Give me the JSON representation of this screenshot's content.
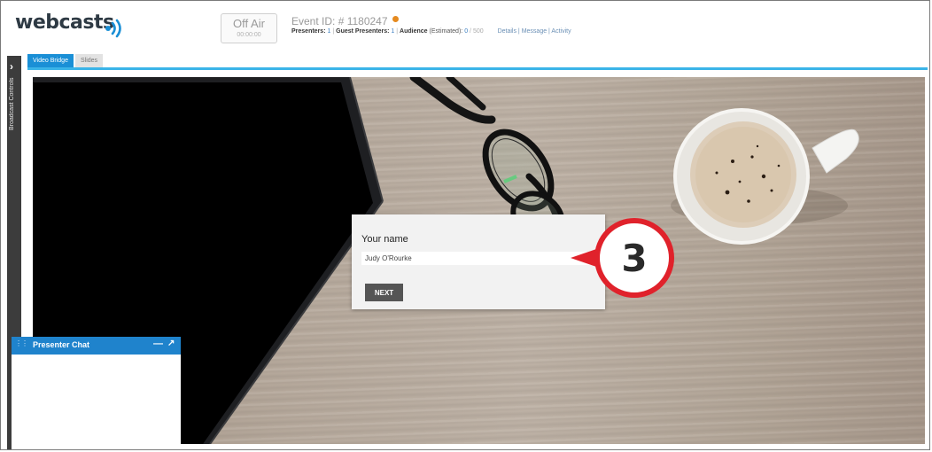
{
  "header": {
    "logo_text": "webcasts",
    "status": "Off Air",
    "timer": "00:00:00",
    "event_id": "Event ID: # 1180247",
    "presenters_label": "Presenters:",
    "presenters_count": "1",
    "guest_label": "Guest Presenters:",
    "guest_count": "1",
    "audience_label": "Audience",
    "audience_note": "(Estimated):",
    "audience_count": "0",
    "audience_max": "500",
    "links": "Details | Message | Activity"
  },
  "tabs": [
    {
      "label": "Video Bridge",
      "active": true
    },
    {
      "label": "Slides",
      "active": false
    }
  ],
  "rail": {
    "label": "Broadcast Controls"
  },
  "dialog": {
    "label": "Your name",
    "name_value": "Judy O'Rourke",
    "button_label": "NEXT"
  },
  "callout": {
    "number": "3",
    "color": "#e0222b"
  },
  "chat": {
    "title": "Presenter Chat",
    "minimize": "—",
    "popout": "↗",
    "header_color": "#1f83cc"
  },
  "colors": {
    "accent": "#1a8fd6",
    "tab_line": "#3ab4e8"
  }
}
